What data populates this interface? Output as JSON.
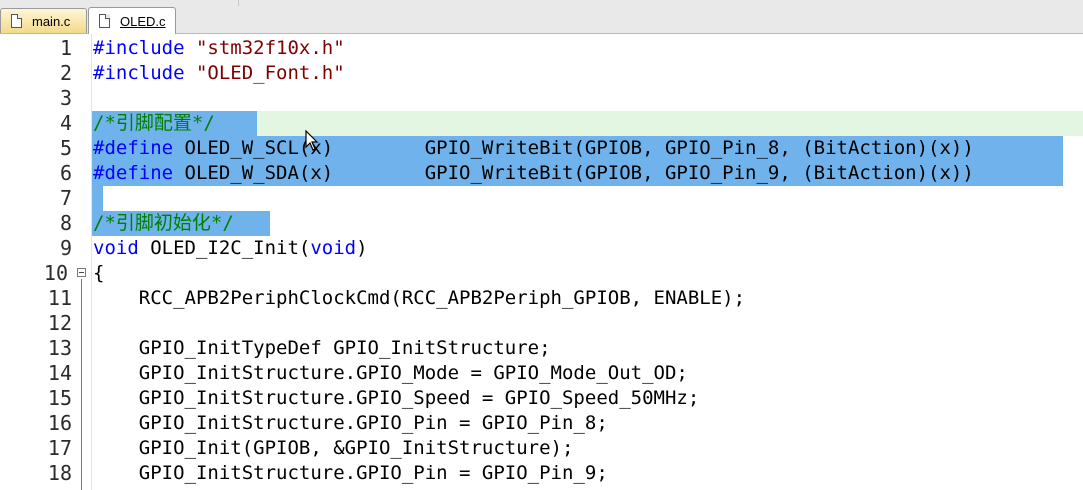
{
  "tabs": [
    {
      "label": "main.c",
      "active": false
    },
    {
      "label": "OLED.c",
      "active": true
    }
  ],
  "lines": [
    {
      "num": "1",
      "pp": "#include ",
      "str": "\"stm32f10x.h\""
    },
    {
      "num": "2",
      "pp": "#include ",
      "str": "\"OLED_Font.h\""
    },
    {
      "num": "3"
    },
    {
      "num": "4",
      "cmt": "/*引脚配置*/"
    },
    {
      "num": "5",
      "pp": "#define",
      "text": " OLED_W_SCL(x)        GPIO_WriteBit(GPIOB, GPIO_Pin_8, (BitAction)(x))"
    },
    {
      "num": "6",
      "pp": "#define",
      "text": " OLED_W_SDA(x)        GPIO_WriteBit(GPIOB, GPIO_Pin_9, (BitAction)(x))"
    },
    {
      "num": "7"
    },
    {
      "num": "8",
      "cmt": "/*引脚初始化*/"
    },
    {
      "num": "9",
      "kw": "void",
      "text": " OLED_I2C_Init(",
      "kw2": "void",
      "text2": ")"
    },
    {
      "num": "10",
      "text": "{"
    },
    {
      "num": "11",
      "text": "    RCC_APB2PeriphClockCmd(RCC_APB2Periph_GPIOB, ENABLE);"
    },
    {
      "num": "12"
    },
    {
      "num": "13",
      "text": "    GPIO_InitTypeDef GPIO_InitStructure;"
    },
    {
      "num": "14",
      "text": "    GPIO_InitStructure.GPIO_Mode = GPIO_Mode_Out_OD;"
    },
    {
      "num": "15",
      "text": "    GPIO_InitStructure.GPIO_Speed = GPIO_Speed_50MHz;"
    },
    {
      "num": "16",
      "text": "    GPIO_InitStructure.GPIO_Pin = GPIO_Pin_8;"
    },
    {
      "num": "17",
      "text": "    GPIO_Init(GPIOB, &GPIO_InitStructure);"
    },
    {
      "num": "18",
      "text": "    GPIO_InitStructure.GPIO_Pin = GPIO_Pin_9;"
    }
  ],
  "colors": {
    "selection": "#6fb2ec",
    "current_line": "#e2f6e2",
    "keyword": "#0000ff",
    "string": "#800000",
    "comment": "#008000"
  }
}
